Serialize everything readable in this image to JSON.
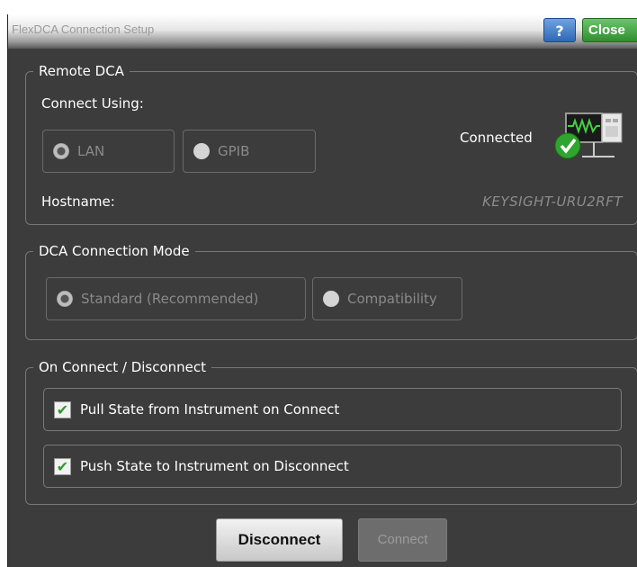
{
  "window": {
    "title": "FlexDCA Connection Setup",
    "help_label": "?",
    "close_label": "Close"
  },
  "remote_dca": {
    "legend": "Remote DCA",
    "connect_using_label": "Connect Using:",
    "options": [
      {
        "label": "LAN",
        "selected": true
      },
      {
        "label": "GPIB",
        "selected": false
      }
    ],
    "status_text": "Connected",
    "hostname_label": "Hostname:",
    "hostname_value": "KEYSIGHT-URU2RFT"
  },
  "connection_mode": {
    "legend": "DCA Connection Mode",
    "options": [
      {
        "label": "Standard (Recommended)",
        "selected": true
      },
      {
        "label": "Compatibility",
        "selected": false
      }
    ]
  },
  "on_connect": {
    "legend": "On Connect / Disconnect",
    "items": [
      {
        "label": "Pull State from Instrument on Connect",
        "checked": true
      },
      {
        "label": "Push State to Instrument on Disconnect",
        "checked": true
      }
    ]
  },
  "actions": {
    "disconnect_label": "Disconnect",
    "connect_label": "Connect"
  }
}
